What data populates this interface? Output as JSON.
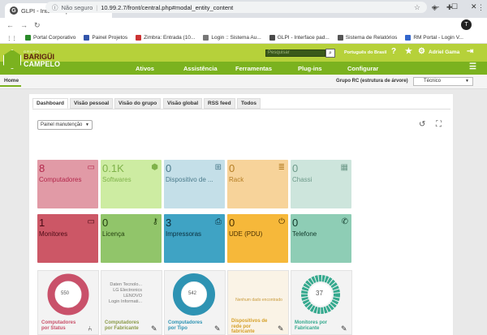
{
  "browser": {
    "tab_title": "GLPI - Interface padrão",
    "tab_favicon": "G",
    "url_secure_label": "Não seguro",
    "url": "10.99.2.7/front/central.php#modal_entity_content",
    "profile_initial": "T"
  },
  "bookmarks": [
    {
      "label": "Portal Corporativo",
      "color": "#2a8a2a"
    },
    {
      "label": "Painel Projetos",
      "color": "#3355aa"
    },
    {
      "label": "Zimbra: Entrada (10...",
      "color": "#cc3333"
    },
    {
      "label": "Login :: Sistema Au...",
      "color": "#777777"
    },
    {
      "label": "GLPI - Interface pad...",
      "color": "#4a4a4a"
    },
    {
      "label": "Sistema de Relatórios",
      "color": "#555555"
    },
    {
      "label": "RM Portal - Login V...",
      "color": "#3366cc"
    }
  ],
  "header": {
    "logo_small": "GRUPO",
    "logo_line1": "BARIGÜI",
    "logo_line2": "CAMPELO",
    "search_placeholder": "Pesquisar",
    "language": "Português do Brasil",
    "user": "Adriel Gama"
  },
  "menu": [
    "Ativos",
    "Assistência",
    "Ferramentas",
    "Plug-ins",
    "Configurar"
  ],
  "breadcrumb": {
    "home": "Home"
  },
  "group": {
    "label": "Grupo RC (estrutura de árvore)",
    "value": "Técnico"
  },
  "tabs": [
    "Dashboard",
    "Visão pessoal",
    "Visão do grupo",
    "Visão global",
    "RSS feed",
    "Todos"
  ],
  "dashboard_select": "Painel manutenção",
  "tiles": [
    {
      "value": "8",
      "label": "Computadores",
      "icon": "laptop-icon",
      "glyph": "💻",
      "bg": "#e19aa6",
      "fg": "#b2264a"
    },
    {
      "value": "0.1K",
      "label": "Softwares",
      "icon": "cube-icon",
      "glyph": "⬢",
      "bg": "#cdeca2",
      "fg": "#7fb24a"
    },
    {
      "value": "0",
      "label": "Dispositivo de ...",
      "icon": "network-icon",
      "glyph": "⊞",
      "bg": "#c4dfe8",
      "fg": "#4a7a8a"
    },
    {
      "value": "0",
      "label": "Rack",
      "icon": "server-icon",
      "glyph": "≣",
      "bg": "#f7d39a",
      "fg": "#b57e24"
    },
    {
      "value": "0",
      "label": "Chassi",
      "icon": "grid-icon",
      "glyph": "▦",
      "bg": "#cde5dc",
      "fg": "#6e9a8a"
    },
    {
      "value": "1",
      "label": "Monitores",
      "icon": "monitor-icon",
      "glyph": "🖵",
      "bg": "#cc5766",
      "fg": "#4a0a14"
    },
    {
      "value": "0",
      "label": "Licença",
      "icon": "key-icon",
      "glyph": "🔑",
      "bg": "#91c56a",
      "fg": "#24400f"
    },
    {
      "value": "3",
      "label": "Impressoras",
      "icon": "printer-icon",
      "glyph": "🖶",
      "bg": "#3fa3c4",
      "fg": "#0a2e3c"
    },
    {
      "value": "0",
      "label": "UDE (PDU)",
      "icon": "plug-icon",
      "glyph": "⏻",
      "bg": "#f6b83a",
      "fg": "#4a3000"
    },
    {
      "value": "0",
      "label": "Telefone",
      "icon": "phone-icon",
      "glyph": "✆",
      "bg": "#8ecdb5",
      "fg": "#123a2b"
    }
  ],
  "widgets": [
    {
      "title": "Computadores por Status",
      "center": "550",
      "color": "#c9516a"
    },
    {
      "title": "Computadores por Fabricante",
      "list": [
        "Daten Tecnolo...",
        "LG Electronics",
        "LENOVO",
        "Login Informati..."
      ],
      "color": "#8a9a48"
    },
    {
      "title": "Computadores por Tipo",
      "center": "542",
      "color": "#2e93b3"
    },
    {
      "title": "Dispositivos de rede por fabricante",
      "nodata": "Nenhum dado encontrado",
      "color": "#d6a12a"
    },
    {
      "title": "Monitores por Fabricante",
      "center": "37",
      "color": "#35a98e"
    }
  ]
}
